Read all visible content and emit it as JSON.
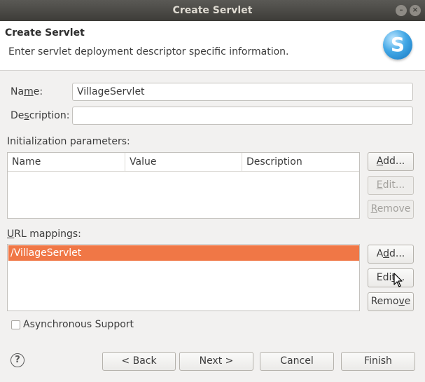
{
  "window": {
    "title": "Create Servlet",
    "minimize_glyph": "–",
    "close_glyph": "×"
  },
  "header": {
    "title": "Create Servlet",
    "description": "Enter servlet deployment descriptor specific information.",
    "logo_letter": "S"
  },
  "form": {
    "name_label_pre": "Na",
    "name_label_mnemonic": "m",
    "name_label_post": "e:",
    "name_value": "VillageServlet",
    "description_label_pre": "De",
    "description_label_mnemonic": "s",
    "description_label_post": "cription:",
    "description_value": ""
  },
  "init_params": {
    "label": "Initialization parameters:",
    "columns": [
      "Name",
      "Value",
      "Description"
    ],
    "rows": [],
    "buttons": {
      "add_pre": "",
      "add_mn": "A",
      "add_post": "dd...",
      "edit_pre": "",
      "edit_mn": "E",
      "edit_post": "dit...",
      "remove_pre": "",
      "remove_mn": "R",
      "remove_post": "emove"
    }
  },
  "url_mappings": {
    "label_pre": "",
    "label_mn": "U",
    "label_post": "RL mappings:",
    "rows": [
      "/VillageServlet"
    ],
    "buttons": {
      "add_pre": "A",
      "add_mn": "d",
      "add_post": "d...",
      "edit_pre": "Edi",
      "edit_mn": "t",
      "edit_post": "...",
      "remove_pre": "Remo",
      "remove_mn": "v",
      "remove_post": "e"
    }
  },
  "async": {
    "label": "Asynchronous Support",
    "checked": false
  },
  "footer": {
    "help_glyph": "?",
    "back": "< Back",
    "next": "Next >",
    "cancel": "Cancel",
    "finish": "Finish"
  }
}
